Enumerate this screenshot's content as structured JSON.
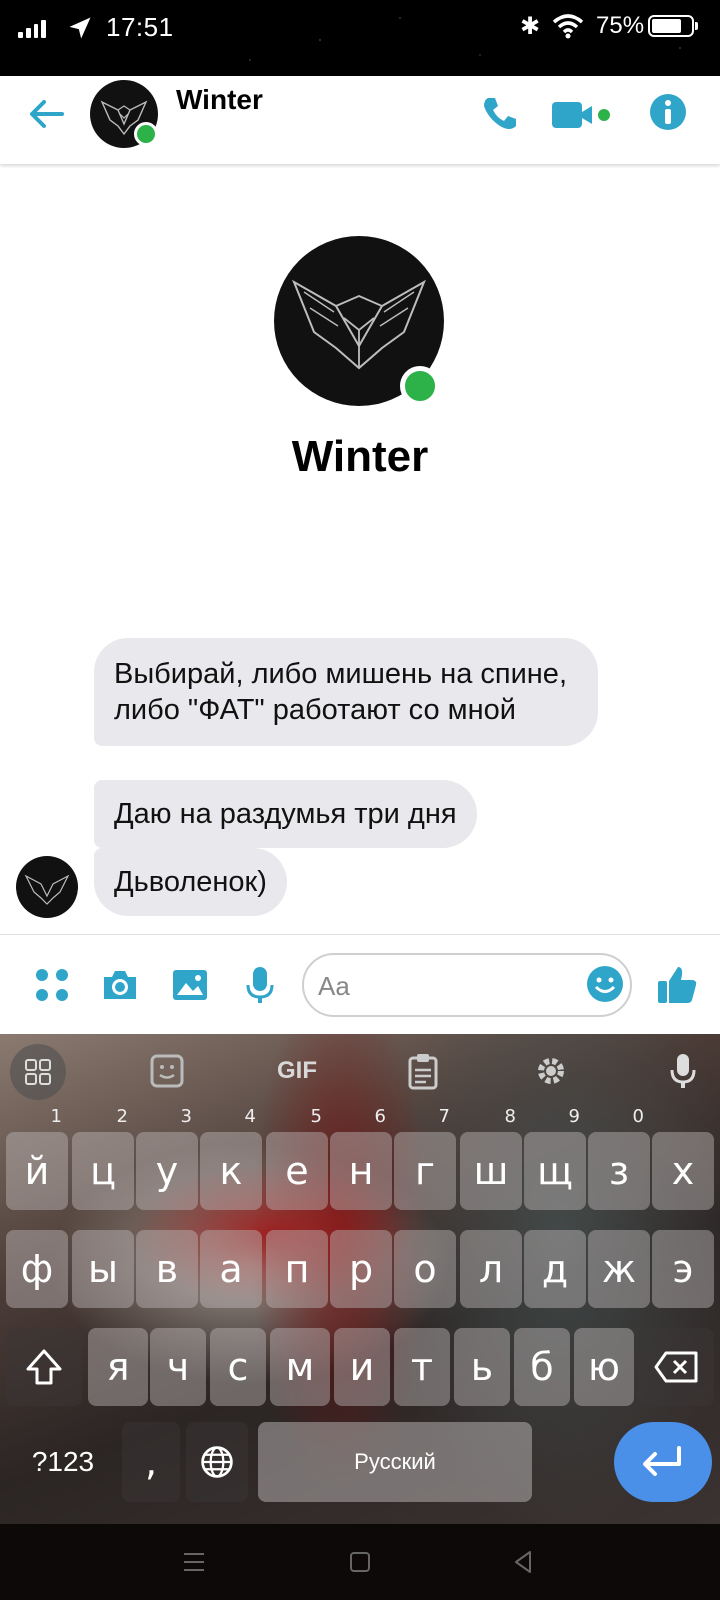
{
  "status_bar": {
    "time": "17:51",
    "battery": "75%",
    "battery_level": 0.75
  },
  "header": {
    "contact_name": "Winter",
    "online": true
  },
  "profile": {
    "name": "Winter"
  },
  "messages": [
    {
      "text": "Выбирай, либо мишень на спине, либо \"ФАТ\" работают со мной"
    },
    {
      "text": "Даю на раздумья три дня"
    },
    {
      "text": "Дьволенок)"
    }
  ],
  "composer": {
    "placeholder": "Aa"
  },
  "keyboard": {
    "gif_label": "GIF",
    "row1": [
      {
        "k": "й",
        "n": "1"
      },
      {
        "k": "ц",
        "n": "2"
      },
      {
        "k": "у",
        "n": "3"
      },
      {
        "k": "к",
        "n": "4"
      },
      {
        "k": "е",
        "n": "5"
      },
      {
        "k": "н",
        "n": "6"
      },
      {
        "k": "г",
        "n": "7"
      },
      {
        "k": "ш",
        "n": "8"
      },
      {
        "k": "щ",
        "n": "9"
      },
      {
        "k": "з",
        "n": "0"
      },
      {
        "k": "х",
        "n": ""
      }
    ],
    "row2": [
      "ф",
      "ы",
      "в",
      "а",
      "п",
      "р",
      "о",
      "л",
      "д",
      "ж",
      "э"
    ],
    "row3": [
      "я",
      "ч",
      "с",
      "м",
      "и",
      "т",
      "ь",
      "б",
      "ю"
    ],
    "symbols_label": "?123",
    "comma_label": ",",
    "space_label": "Русский"
  }
}
